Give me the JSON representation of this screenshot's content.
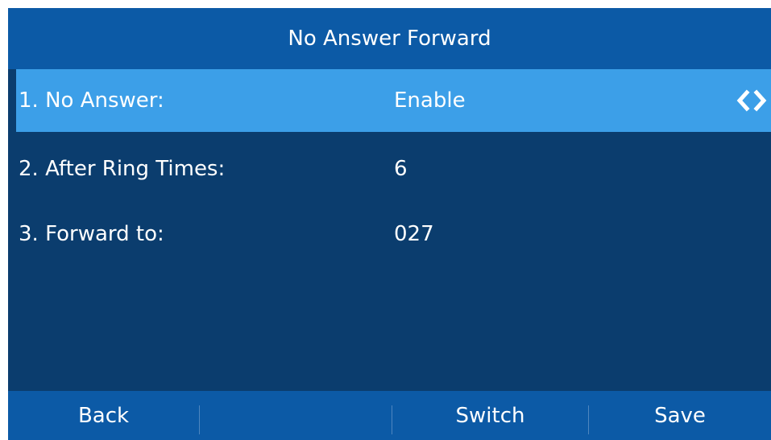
{
  "title": "No Answer Forward",
  "rows": [
    {
      "label": "1.  No Answer:",
      "value": "Enable",
      "selected": true
    },
    {
      "label": "2.  After Ring Times:",
      "value": "6",
      "selected": false
    },
    {
      "label": "3.  Forward to:",
      "value": "027",
      "selected": false
    }
  ],
  "softkeys": {
    "back": "Back",
    "empty": "",
    "switch": "Switch",
    "save": "Save"
  },
  "icons": {
    "prev": "chevron-left-icon",
    "next": "chevron-right-icon"
  },
  "colors": {
    "background": "#0b3d6e",
    "title_bar": "#0c5aa6",
    "selected_row": "#3c9fe8",
    "text": "#ffffff"
  }
}
